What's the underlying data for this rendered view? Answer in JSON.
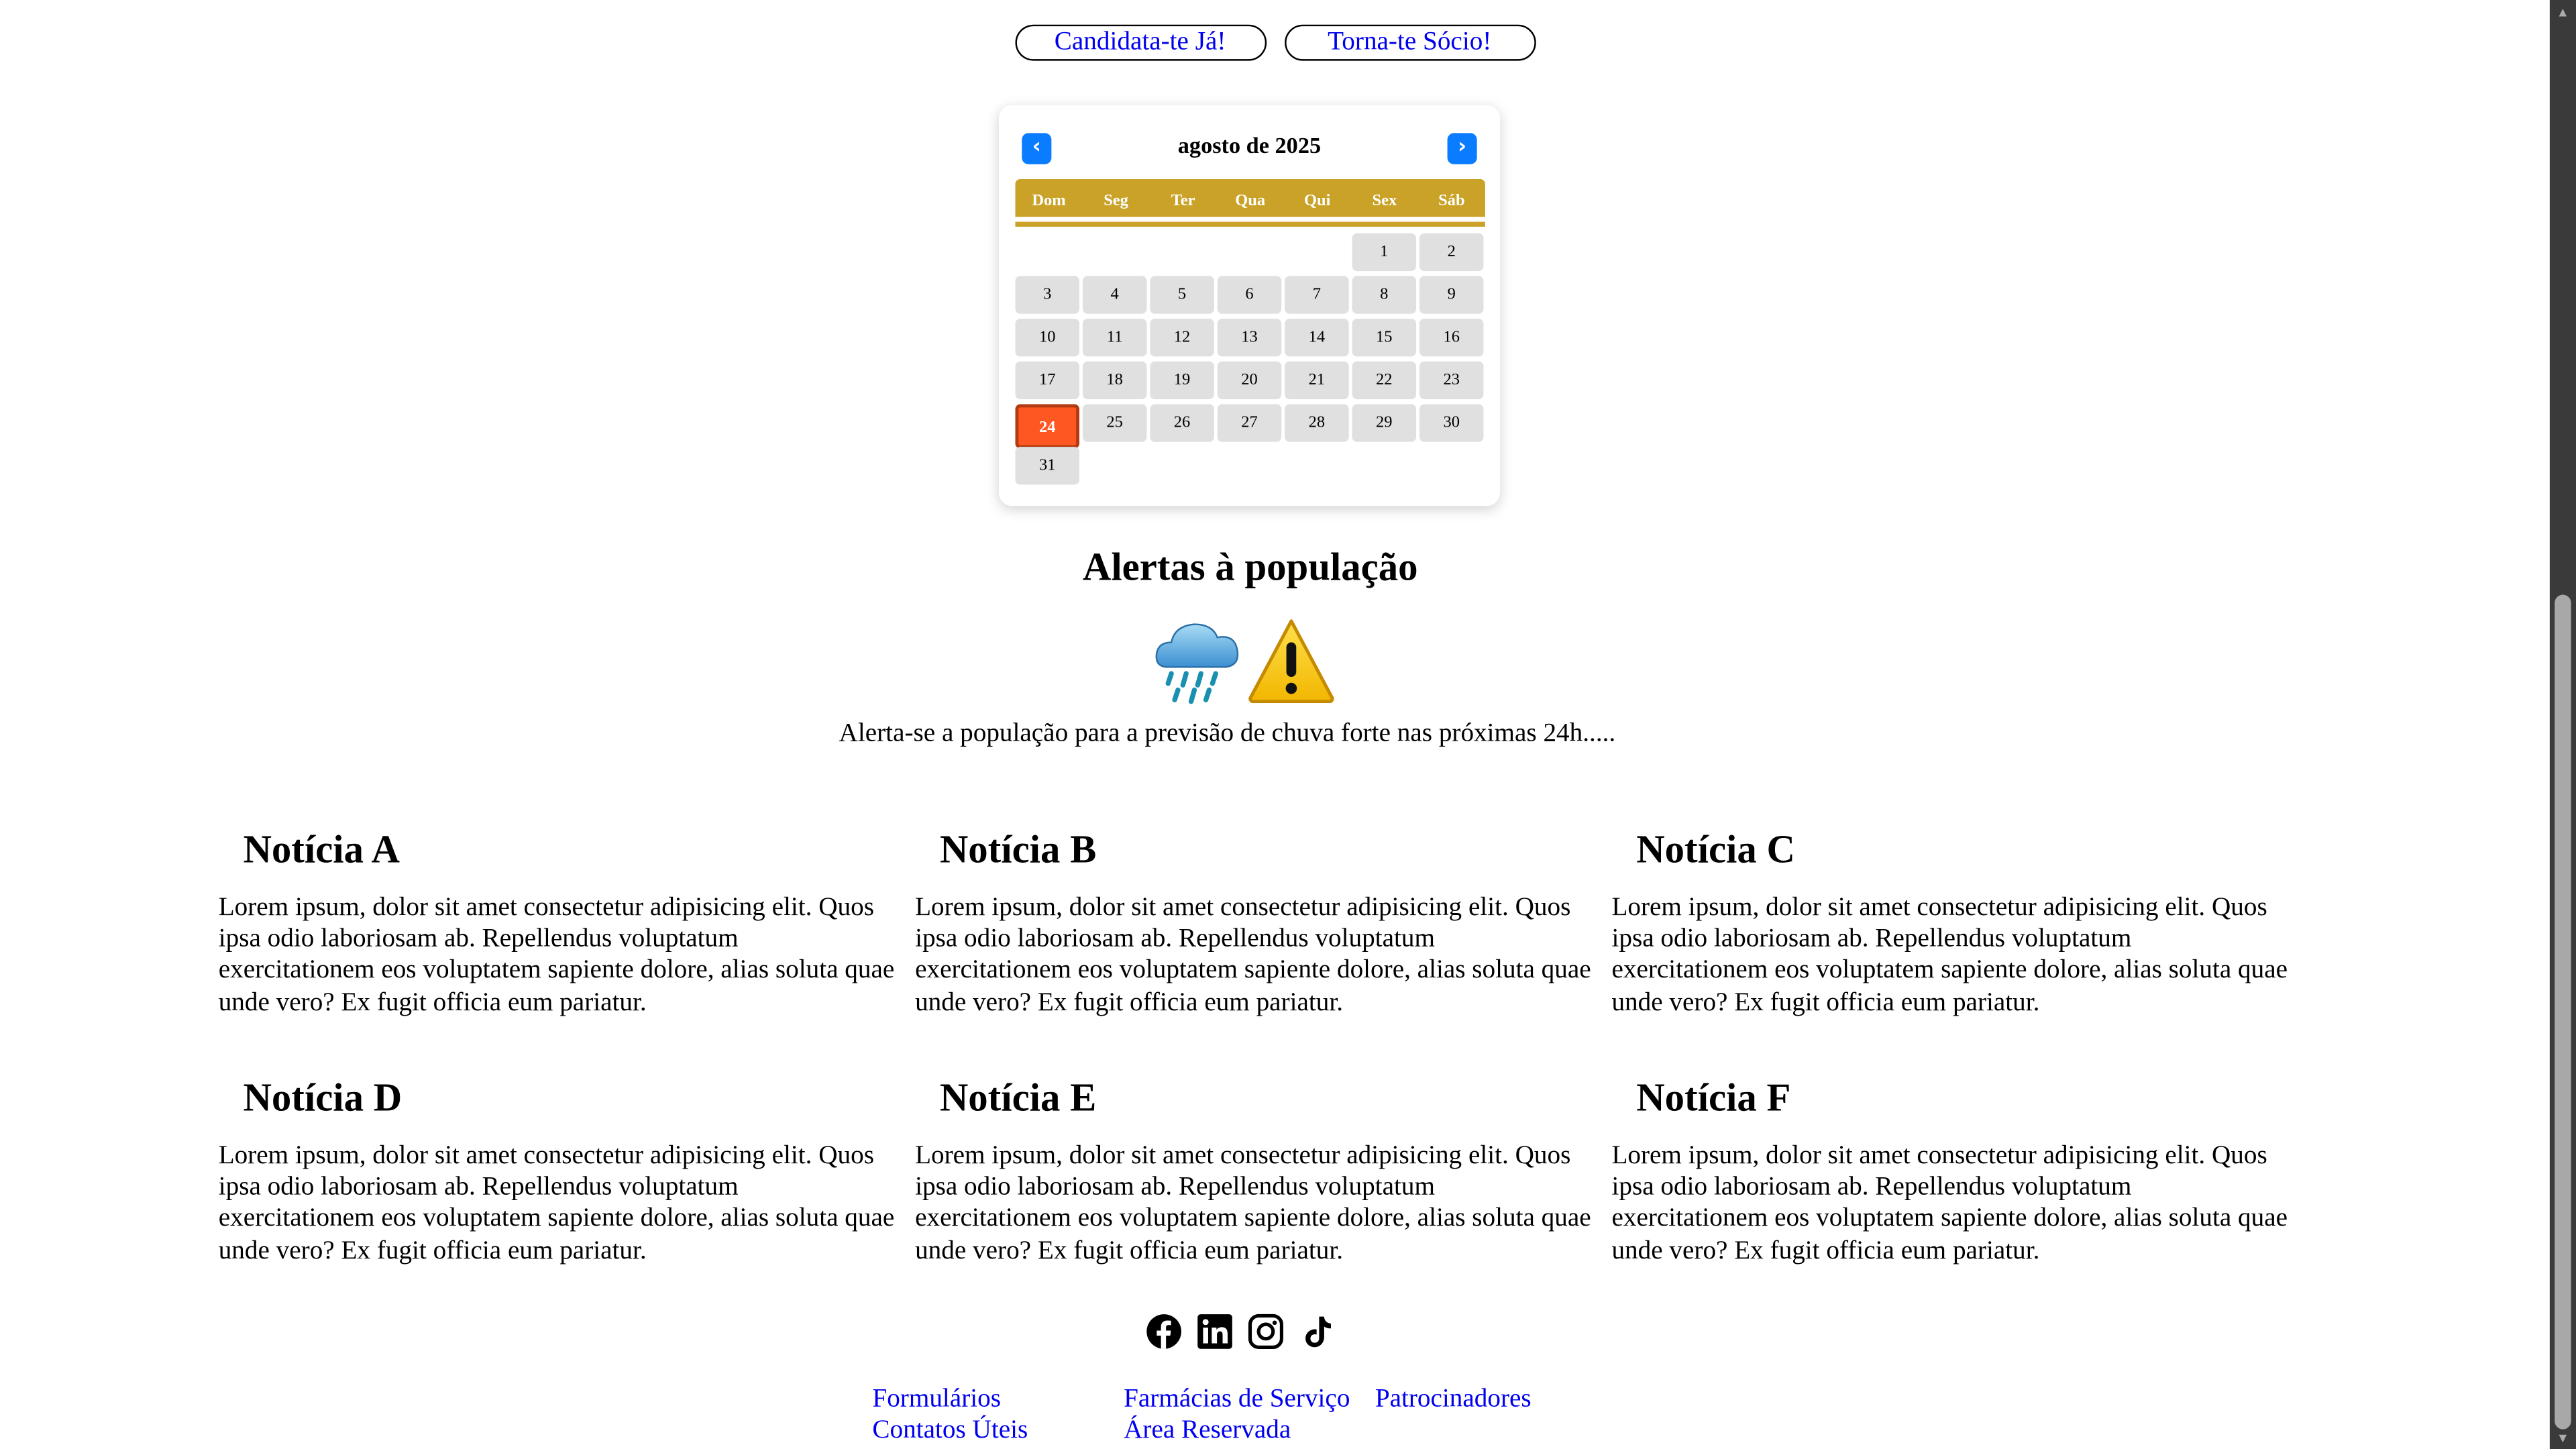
{
  "actions": {
    "apply_label": "Candidata-te Já!",
    "member_label": "Torna-te Sócio!"
  },
  "calendar": {
    "title": "agosto de 2025",
    "prev_icon": "‹",
    "next_icon": "›",
    "weekdays": [
      "Dom",
      "Seg",
      "Ter",
      "Qua",
      "Qui",
      "Sex",
      "Sáb"
    ],
    "leading_blanks": 5,
    "days": [
      "1",
      "2",
      "3",
      "4",
      "5",
      "6",
      "7",
      "8",
      "9",
      "10",
      "11",
      "12",
      "13",
      "14",
      "15",
      "16",
      "17",
      "18",
      "19",
      "20",
      "21",
      "22",
      "23",
      "24",
      "25",
      "26",
      "27",
      "28",
      "29",
      "30",
      "31"
    ],
    "today": "24",
    "accent_color": "#c9a227",
    "today_color": "#ff5722",
    "nav_color": "#0a7cff"
  },
  "alerts": {
    "title": "Alertas à população",
    "icons": [
      "rain-cloud-icon",
      "warning-icon"
    ],
    "text": "Alerta-se a população para a previsão de chuva forte nas próximas 24h....."
  },
  "news": [
    {
      "title": "Notícia A",
      "body": "Lorem ipsum, dolor sit amet consectetur adipisicing elit. Quos ipsa odio laboriosam ab. Repellendus voluptatum exercitationem eos voluptatem sapiente dolore, alias soluta quae unde vero? Ex fugit officia eum pariatur."
    },
    {
      "title": "Notícia B",
      "body": "Lorem ipsum, dolor sit amet consectetur adipisicing elit. Quos ipsa odio laboriosam ab. Repellendus voluptatum exercitationem eos voluptatem sapiente dolore, alias soluta quae unde vero? Ex fugit officia eum pariatur."
    },
    {
      "title": "Notícia C",
      "body": "Lorem ipsum, dolor sit amet consectetur adipisicing elit. Quos ipsa odio laboriosam ab. Repellendus voluptatum exercitationem eos voluptatem sapiente dolore, alias soluta quae unde vero? Ex fugit officia eum pariatur."
    },
    {
      "title": "Notícia D",
      "body": "Lorem ipsum, dolor sit amet consectetur adipisicing elit. Quos ipsa odio laboriosam ab. Repellendus voluptatum exercitationem eos voluptatem sapiente dolore, alias soluta quae unde vero? Ex fugit officia eum pariatur."
    },
    {
      "title": "Notícia E",
      "body": "Lorem ipsum, dolor sit amet consectetur adipisicing elit. Quos ipsa odio laboriosam ab. Repellendus voluptatum exercitationem eos voluptatem sapiente dolore, alias soluta quae unde vero? Ex fugit officia eum pariatur."
    },
    {
      "title": "Notícia F",
      "body": "Lorem ipsum, dolor sit amet consectetur adipisicing elit. Quos ipsa odio laboriosam ab. Repellendus voluptatum exercitationem eos voluptatem sapiente dolore, alias soluta quae unde vero? Ex fugit officia eum pariatur."
    }
  ],
  "social": [
    "facebook-icon",
    "linkedin-icon",
    "instagram-icon",
    "tiktok-icon"
  ],
  "footer": {
    "forms": "Formulários",
    "pharmacies": "Farmácias de Serviço",
    "sponsors": "Patrocinadores",
    "contacts": "Contatos Úteis",
    "reserved": "Área Reservada"
  }
}
